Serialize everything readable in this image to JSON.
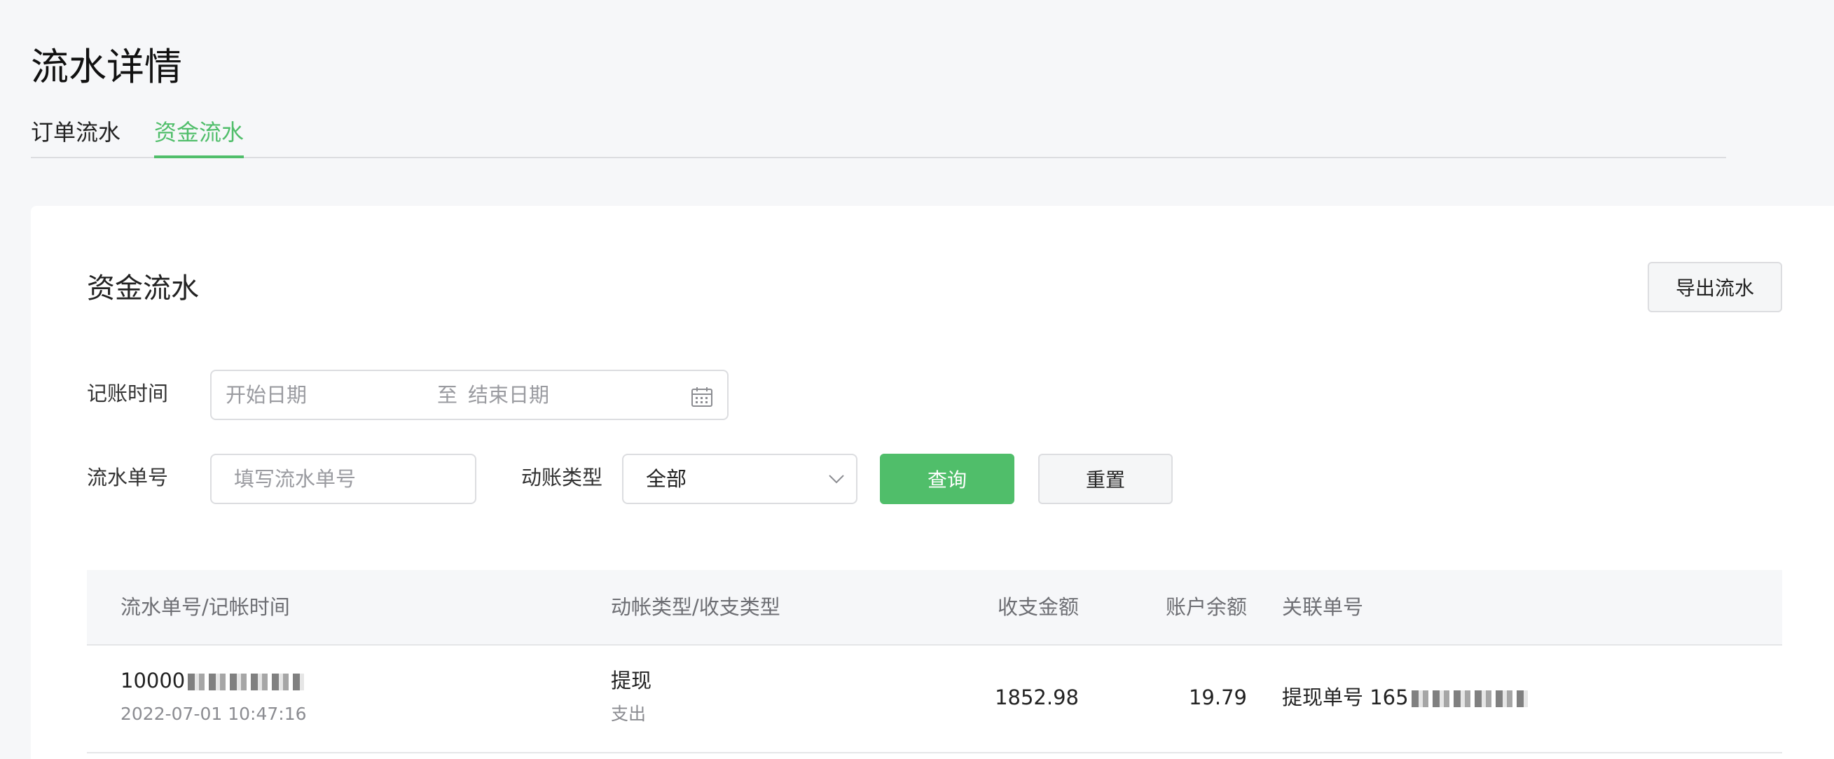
{
  "page": {
    "title": "流水详情"
  },
  "tabs": [
    {
      "label": "订单流水",
      "active": false
    },
    {
      "label": "资金流水",
      "active": true
    }
  ],
  "card": {
    "title": "资金流水",
    "export_label": "导出流水"
  },
  "filters": {
    "date_label": "记账时间",
    "start_placeholder": "开始日期",
    "separator": "至",
    "end_placeholder": "结束日期",
    "serial_label": "流水单号",
    "serial_placeholder": "填写流水单号",
    "type_label": "动账类型",
    "type_value": "全部",
    "query_label": "查询",
    "reset_label": "重置"
  },
  "table": {
    "columns": [
      "流水单号/记帐时间",
      "动帐类型/收支类型",
      "收支金额",
      "账户余额",
      "关联单号"
    ],
    "rows": [
      {
        "serial_prefix": "10000",
        "time": "2022-07-01 10:47:16",
        "type": "提现",
        "direction": "支出",
        "amount": "1852.98",
        "balance": "19.79",
        "related_prefix": "提现单号 165"
      }
    ]
  },
  "colors": {
    "accent": "#50be6a",
    "background": "#f6f7f9"
  }
}
